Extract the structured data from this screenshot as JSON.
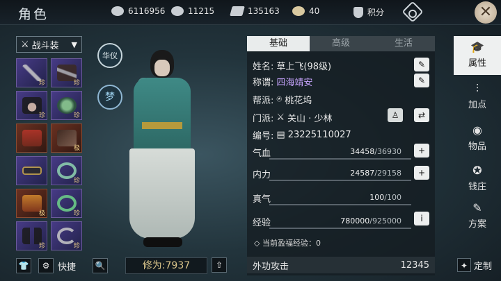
{
  "header": {
    "title": "角色"
  },
  "resources": [
    {
      "icon": "film-reel-icon",
      "value": "6116956"
    },
    {
      "icon": "silver-ingot-icon",
      "value": "11215"
    },
    {
      "icon": "ticket-icon",
      "value": "135163"
    },
    {
      "icon": "gold-ingot-icon",
      "value": "40"
    }
  ],
  "points": {
    "label": "积分"
  },
  "equipment": {
    "set_selector": "战斗装",
    "slots": [
      {
        "grade": "珍",
        "type": "purple"
      },
      {
        "grade": "珍",
        "type": "purple"
      },
      {
        "grade": "珍",
        "type": "purple"
      },
      {
        "grade": "珍",
        "type": "purple"
      },
      {
        "grade": "",
        "type": "red"
      },
      {
        "grade": "极",
        "type": "red"
      },
      {
        "grade": "",
        "type": "purple"
      },
      {
        "grade": "珍",
        "type": "purple"
      },
      {
        "grade": "极",
        "type": "red"
      },
      {
        "grade": "珍",
        "type": "purple"
      },
      {
        "grade": "珍",
        "type": "purple"
      },
      {
        "grade": "珍",
        "type": "purple"
      }
    ],
    "quick_label": "快捷"
  },
  "character": {
    "emblem1": "华仪",
    "emblem2": "梦",
    "power_label": "修为:7937"
  },
  "panel": {
    "tabs": [
      "基础",
      "高级",
      "生活"
    ],
    "name_label": "姓名:",
    "name_value": "草上飞(98级)",
    "title_label": "称谓:",
    "title_value": "四海靖安",
    "guild_label": "帮派:",
    "guild_value": "桃花坞",
    "sect_label": "门派:",
    "sect_value": "关山 · 少林",
    "id_label": "编号:",
    "id_value": "23225110027",
    "stats": [
      {
        "label": "气血",
        "current": "34458",
        "max": "/36930",
        "button": "+"
      },
      {
        "label": "内力",
        "current": "24587",
        "max": "/29158",
        "button": "+"
      },
      {
        "label": "真气",
        "current": "100",
        "max": "/100",
        "button": ""
      },
      {
        "label": "经验",
        "current": "780000",
        "max": "/925000",
        "button": "i"
      }
    ],
    "bonus_exp": "◇ 当前盈福经验：0",
    "attack_label": "外功攻击",
    "attack_value": "12345"
  },
  "side_menu": [
    {
      "label": "属性",
      "icon": "mortarboard-icon",
      "glyph": "🎓"
    },
    {
      "label": "加点",
      "icon": "sliders-icon",
      "glyph": "⫶"
    },
    {
      "label": "物品",
      "icon": "bag-icon",
      "glyph": "◉"
    },
    {
      "label": "钱庄",
      "icon": "money-bag-icon",
      "glyph": "✪"
    },
    {
      "label": "方案",
      "icon": "scroll-icon",
      "glyph": "✎"
    }
  ],
  "custom_label": "定制"
}
